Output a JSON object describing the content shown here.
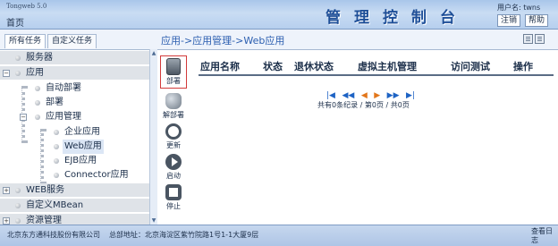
{
  "header": {
    "brand": "Tongweb 5.0",
    "home": "首页",
    "title": "管理控制台",
    "user_label": "用户名:",
    "user_name": "twns",
    "logout": "注销",
    "help": "帮助",
    "colors": {
      "bar": "#b6cfee",
      "title": "#1e4f98"
    }
  },
  "tabs": [
    {
      "label": "所有任务",
      "active": true
    },
    {
      "label": "自定义任务",
      "active": false
    }
  ],
  "tree": [
    {
      "label": "服务器",
      "toggle": "",
      "level": 1
    },
    {
      "label": "应用",
      "toggle": "−",
      "level": 1
    },
    {
      "label": "自动部署",
      "level": 2
    },
    {
      "label": "部署",
      "level": 2
    },
    {
      "label": "应用管理",
      "toggle": "−",
      "level": 2
    },
    {
      "label": "企业应用",
      "level": 3
    },
    {
      "label": "Web应用",
      "level": 3,
      "selected": true
    },
    {
      "label": "EJB应用",
      "level": 3
    },
    {
      "label": "Connector应用",
      "level": 3
    },
    {
      "label": "WEB服务",
      "toggle": "+",
      "level": 1
    },
    {
      "label": "自定义MBean",
      "toggle": "",
      "level": 1
    },
    {
      "label": "资源管理",
      "toggle": "+",
      "level": 1
    }
  ],
  "breadcrumb": "应用->应用管理->Web应用",
  "toolbar": [
    {
      "label": "部署",
      "icon": "deploy-icon",
      "active": true
    },
    {
      "label": "解部署",
      "icon": "undeploy-icon"
    },
    {
      "label": "更新",
      "icon": "refresh-icon"
    },
    {
      "label": "启动",
      "icon": "start-icon"
    },
    {
      "label": "停止",
      "icon": "stop-icon"
    }
  ],
  "table": {
    "columns": [
      "应用名称",
      "状态",
      "退休状态",
      "虚拟主机管理",
      "访问测试",
      "操作"
    ],
    "rows": []
  },
  "pager": {
    "first": "|◀",
    "prev2": "◀◀",
    "prev": "◀",
    "next": "▶",
    "next2": "▶▶",
    "last": "▶|",
    "info": "共有0条纪录 / 第0页 / 共0页"
  },
  "status": {
    "company": "北京东方通科技股份有限公司",
    "address": "总部地址：北京海淀区紫竹院路1号1-1大厦9层",
    "view_log": "查看日志"
  }
}
